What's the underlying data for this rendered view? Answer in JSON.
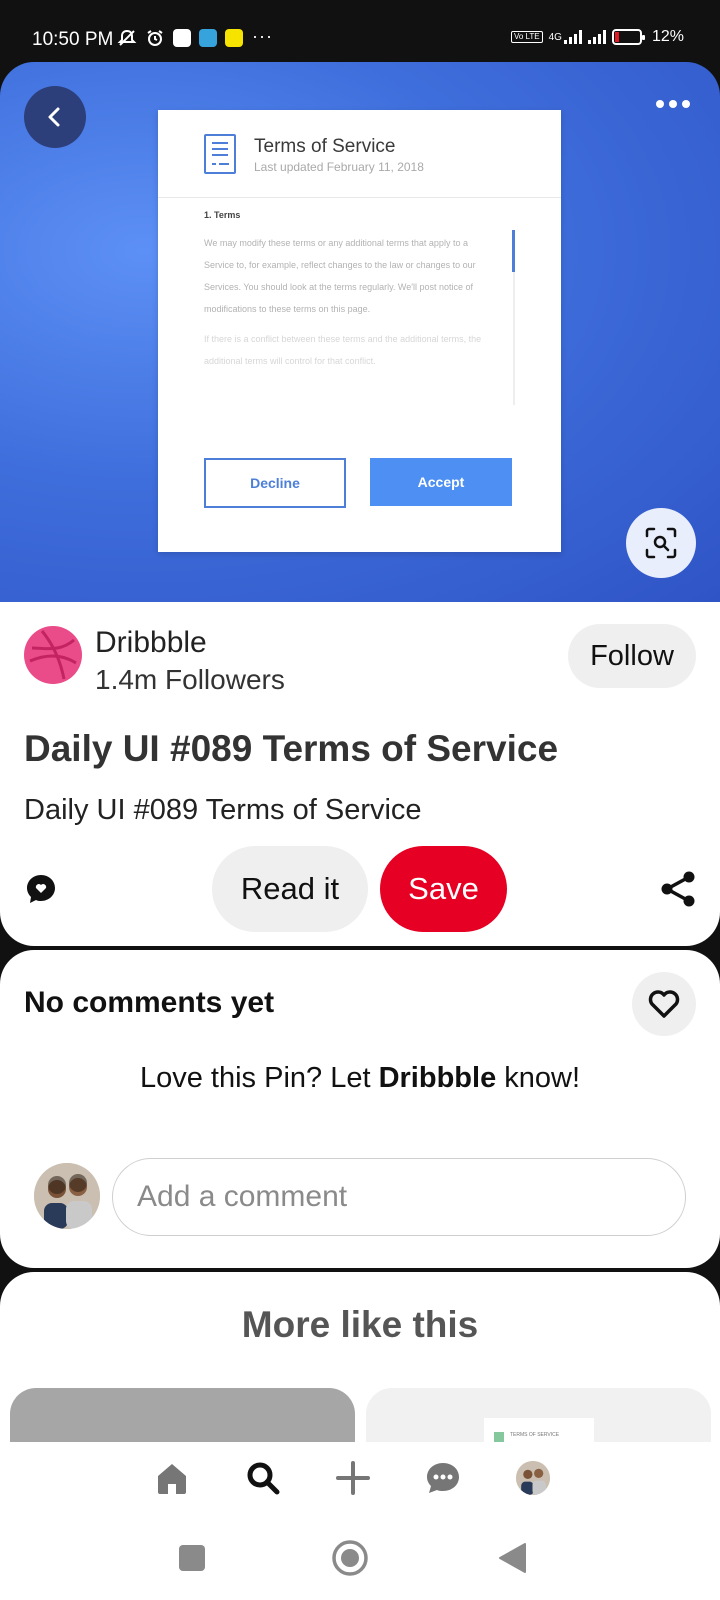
{
  "status_bar": {
    "time": "10:50 PM",
    "overflow": "···",
    "volte": "Vo LTE",
    "network": "4G",
    "battery": "12%",
    "icons": [
      "mute-icon",
      "alarm-icon",
      "phone-app-icon",
      "telegram-icon",
      "snapchat-icon"
    ]
  },
  "pin_image": {
    "card_title": "Terms of Service",
    "card_updated": "Last updated February 11, 2018",
    "section_heading": "1. Terms",
    "paragraph_1": "We may modify these terms or any additional terms that apply to a Service to, for example, reflect changes to the law or changes to our Services. You should look at the terms regularly. We'll post notice of modifications to these terms on this page.",
    "paragraph_2": "If there is a conflict between these terms and the additional terms, the additional terms will control for that conflict.",
    "decline_label": "Decline",
    "accept_label": "Accept",
    "accent_color": "#4d8ff2"
  },
  "creator": {
    "name": "Dribbble",
    "followers": "1.4m Followers",
    "follow_label": "Follow"
  },
  "pin": {
    "title": "Daily UI #089 Terms of Service",
    "description": "Daily UI #089 Terms of Service",
    "read_label": "Read it",
    "save_label": "Save",
    "save_color": "#e60023"
  },
  "comments": {
    "title": "No comments yet",
    "prompt_prefix": "Love this Pin? Let ",
    "prompt_name": "Dribbble",
    "prompt_suffix": " know!",
    "input_placeholder": "Add a comment"
  },
  "more": {
    "title": "More like this",
    "thumb2_text": "TERMS OF SERVICE"
  },
  "tabbar": {
    "tabs": [
      "home-icon",
      "search-icon",
      "create-icon",
      "messages-icon",
      "profile-avatar"
    ],
    "active": "search-icon"
  },
  "navbar": {
    "buttons": [
      "recents-button",
      "home-button",
      "back-button"
    ]
  }
}
